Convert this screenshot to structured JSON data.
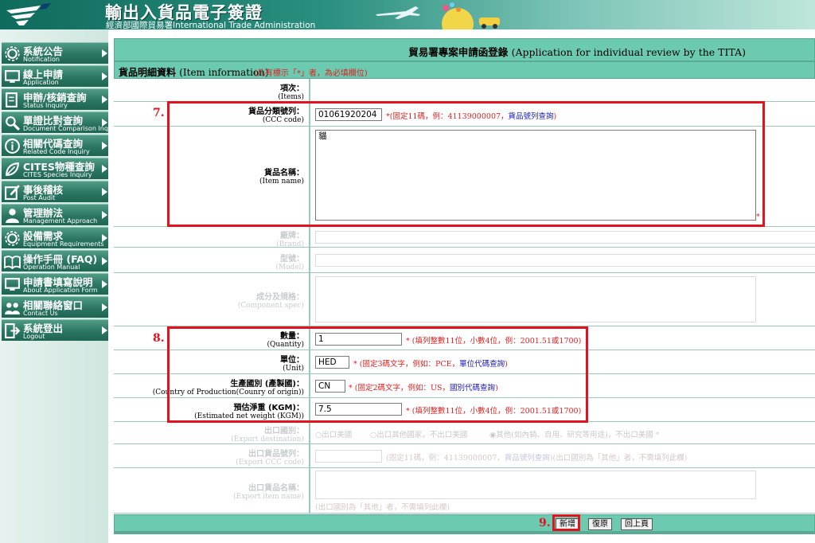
{
  "header": {
    "title": "輸出入貨品電子簽證",
    "subtitle": "經濟部國際貿易署International Trade Administration"
  },
  "sidebar": {
    "items": [
      {
        "zh": "系統公告",
        "en": "Notification",
        "icon": "gear-icon"
      },
      {
        "zh": "線上申請",
        "en": "Application",
        "icon": "monitor-icon"
      },
      {
        "zh": "申辦/核銷查詢",
        "en": "Status Inquiry",
        "icon": "document-edit-icon"
      },
      {
        "zh": "單證比對查詢",
        "en": "Document Comparison Inquiry",
        "icon": "magnifier-icon"
      },
      {
        "zh": "相關代碼查詢",
        "en": "Related Code Inquiry",
        "icon": "info-icon"
      },
      {
        "zh": "CITES物種查詢",
        "en": "CITES Species Inquiry",
        "icon": "leaf-icon"
      },
      {
        "zh": "事後稽核",
        "en": "Post Audit",
        "icon": "pencil-icon"
      },
      {
        "zh": "管理辦法",
        "en": "Management Approach",
        "icon": "person-icon"
      },
      {
        "zh": "設備需求",
        "en": "Equipment Requirements",
        "icon": "gear-icon"
      },
      {
        "zh": "操作手冊 (FAQ)",
        "en": "Operation Manual",
        "icon": "book-icon"
      },
      {
        "zh": "申請書填寫說明",
        "en": "About Application Form",
        "icon": "monitor-icon"
      },
      {
        "zh": "相關聯絡窗口",
        "en": "Contact Us",
        "icon": "people-icon"
      },
      {
        "zh": "系統登出",
        "en": "Logout",
        "icon": "logout-icon"
      }
    ]
  },
  "page": {
    "title": "貿易署專案申請函登錄",
    "title_en": "(Application for individual review by the TITA)"
  },
  "section": {
    "title": "貨品明細資料",
    "title_en": "(Item information)",
    "note": "(凡有標示「*」者，為必填欄位)"
  },
  "fields": {
    "items": {
      "zh": "項次：",
      "en": "(Items)"
    },
    "ccc": {
      "zh": "貨品分類號列：",
      "en": "(CCC code)",
      "value": "01061920204",
      "note": "*(固定11碼，例：41139000007，",
      "link": "貨品號列查詢",
      "note_end": ")"
    },
    "item_name": {
      "zh": "貨品名稱：",
      "en": "(Item name)",
      "value": "貓",
      "star": "*"
    },
    "brand": {
      "zh": "廠牌：",
      "en": "(Brand)"
    },
    "model": {
      "zh": "型號：",
      "en": "(Model)"
    },
    "components": {
      "zh": "成分及規格：",
      "en": "(Component spec)"
    },
    "quantity": {
      "zh": "數量：",
      "en": "(Quantity)",
      "value": "1",
      "note": "* (填列整數11位，小數4位，例：2001.51或1700)"
    },
    "unit": {
      "zh": "單位：",
      "en": "(Unit)",
      "value": "HED",
      "note": "* (固定3碼文字，例如：PCE，",
      "link": "單位代碼查詢",
      "note_end": ")"
    },
    "country": {
      "zh": "生產國別 (產製國)：",
      "en": "(Country of Production(Counry of origin))",
      "value": "CN",
      "note": "* (固定2碼文字，例如：US，",
      "link": "國別代碼查詢",
      "note_end": ")"
    },
    "weight": {
      "zh": "預估淨重 (KGM)：",
      "en": "(Estimated net weight (KGM))",
      "value": "7.5",
      "note": "* (填列整數11位，小數4位，例：2001.51或1700)"
    },
    "export_dest": {
      "zh": "出口國別：",
      "en": "(Export destination)",
      "opt1": "出口美國",
      "opt2": "出口其他國家，不出口美國",
      "opt3": "其他(如內銷、自用、研究等用途)，不出口美國",
      "star": "*"
    },
    "export_ccc": {
      "zh": "出口貨品號列：",
      "en": "(Export CCC code)",
      "note": "(固定11碼，例：41139000007，",
      "link": "貨品號列查詢",
      "note_end": ")(出口國別為「其他」者，不需填列此欄)"
    },
    "export_name": {
      "zh": "出口貨品名稱：",
      "en": "(Export item name)",
      "note": "(出口國別為「其他」者，不需填列此欄)"
    }
  },
  "annotations": {
    "step7": "7.",
    "step8": "8.",
    "step9": "9."
  },
  "buttons": {
    "add": "新增",
    "reset": "復原",
    "back": "回上頁"
  },
  "colors": {
    "accent": "#6ccab0",
    "highlight": "#e0141e",
    "nav": "#2a7662"
  }
}
